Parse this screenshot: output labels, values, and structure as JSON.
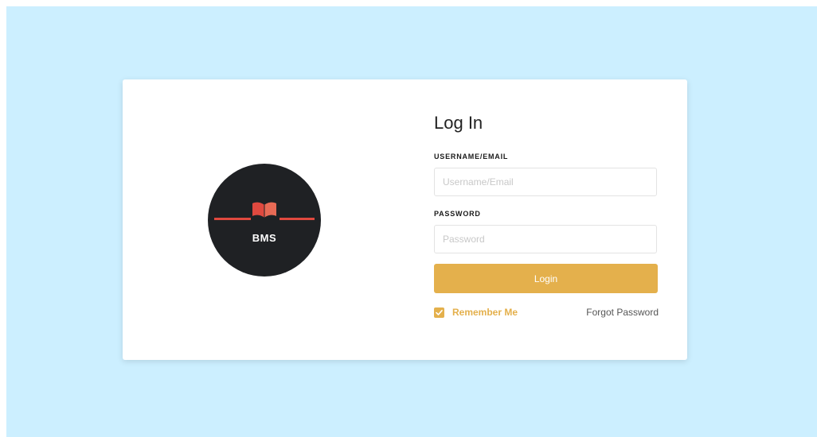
{
  "logo": {
    "text": "BMS"
  },
  "login_form": {
    "title": "Log In",
    "username_label": "USERNAME/EMAIL",
    "username_placeholder": "Username/Email",
    "username_value": "",
    "password_label": "PASSWORD",
    "password_placeholder": "Password",
    "password_value": "",
    "login_button": "Login",
    "remember_me": {
      "label": "Remember Me",
      "checked": true
    },
    "forgot_password": "Forgot Password"
  },
  "colors": {
    "page_background": "#ccefff",
    "accent": "#e4b04c",
    "logo_background": "#1f2124",
    "logo_red": "#e0493f"
  }
}
